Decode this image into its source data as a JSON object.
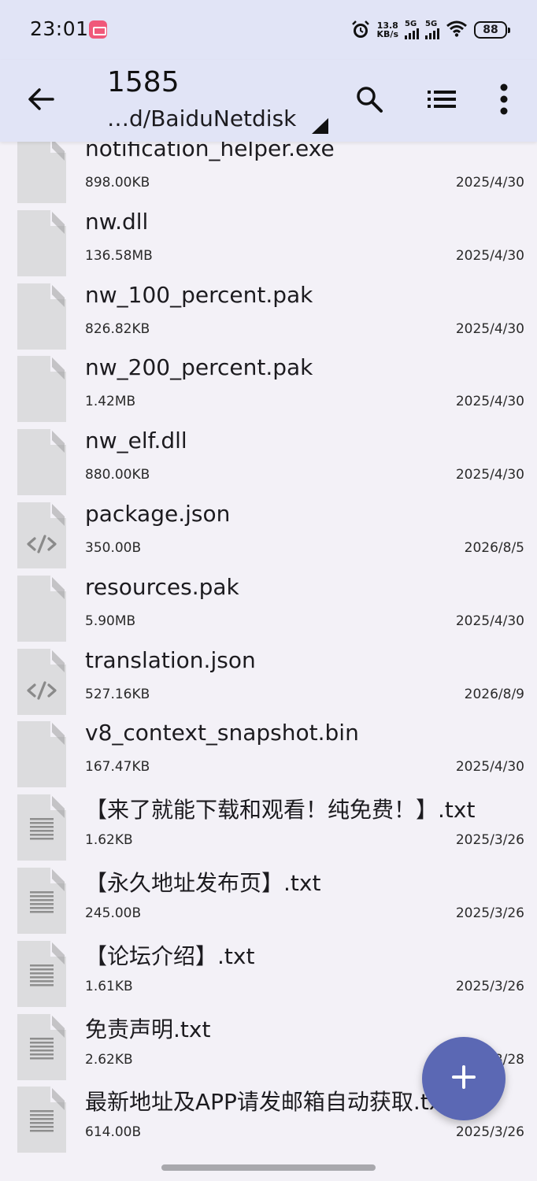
{
  "status": {
    "time": "23:01",
    "net_speed_value": "13.8",
    "net_speed_unit": "KB/s",
    "signal1": "5G",
    "signal2": "5G",
    "battery": "88"
  },
  "appbar": {
    "title": "1585",
    "path": "…d/BaiduNetdisk",
    "icons": [
      "back-arrow-icon",
      "search-icon",
      "list-view-icon",
      "more-vert-icon"
    ]
  },
  "files": [
    {
      "name": "notification_helper.exe",
      "size": "898.00KB",
      "date": "2025/4/30",
      "icon": "generic"
    },
    {
      "name": "nw.dll",
      "size": "136.58MB",
      "date": "2025/4/30",
      "icon": "generic"
    },
    {
      "name": "nw_100_percent.pak",
      "size": "826.82KB",
      "date": "2025/4/30",
      "icon": "generic"
    },
    {
      "name": "nw_200_percent.pak",
      "size": "1.42MB",
      "date": "2025/4/30",
      "icon": "generic"
    },
    {
      "name": "nw_elf.dll",
      "size": "880.00KB",
      "date": "2025/4/30",
      "icon": "generic"
    },
    {
      "name": "package.json",
      "size": "350.00B",
      "date": "2026/8/5",
      "icon": "code"
    },
    {
      "name": "resources.pak",
      "size": "5.90MB",
      "date": "2025/4/30",
      "icon": "generic"
    },
    {
      "name": "translation.json",
      "size": "527.16KB",
      "date": "2026/8/9",
      "icon": "code"
    },
    {
      "name": "v8_context_snapshot.bin",
      "size": "167.47KB",
      "date": "2025/4/30",
      "icon": "generic"
    },
    {
      "name": "【来了就能下载和观看！纯免费！】.txt",
      "size": "1.62KB",
      "date": "2025/3/26",
      "icon": "text"
    },
    {
      "name": "【永久地址发布页】.txt",
      "size": "245.00B",
      "date": "2025/3/26",
      "icon": "text"
    },
    {
      "name": "【论坛介绍】.txt",
      "size": "1.61KB",
      "date": "2025/3/26",
      "icon": "text"
    },
    {
      "name": "免责声明.txt",
      "size": "2.62KB",
      "date": "2025/3/28",
      "icon": "text"
    },
    {
      "name": "最新地址及APP请发邮箱自动获取.txt",
      "size": "614.00B",
      "date": "2025/3/26",
      "icon": "text"
    }
  ],
  "fab": {
    "icon": "plus-icon"
  },
  "colors": {
    "bar_bg": "#e1e4f6",
    "page_bg": "#f3f1f7",
    "fab": "#5b68b4",
    "icon_grey": "#dcdcde"
  }
}
